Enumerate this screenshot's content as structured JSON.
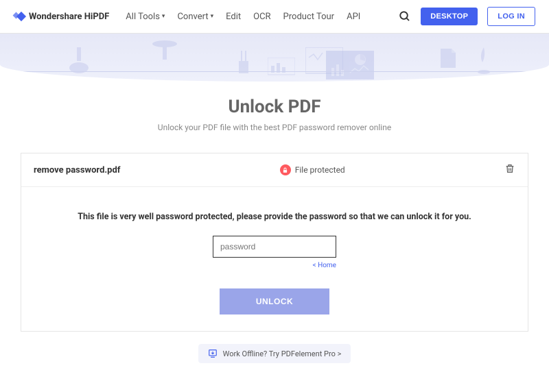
{
  "brand": "Wondershare HiPDF",
  "nav": {
    "all_tools": "All Tools",
    "convert": "Convert",
    "edit": "Edit",
    "ocr": "OCR",
    "product_tour": "Product Tour",
    "api": "API"
  },
  "buttons": {
    "desktop": "DESKTOP",
    "login": "LOG IN"
  },
  "hero": {
    "title": "Unlock PDF",
    "subtitle": "Unlock your PDF file with the best PDF password remover online"
  },
  "file": {
    "name": "remove password.pdf",
    "status": "File protected"
  },
  "content": {
    "message": "This file is very well password protected, please provide the password so that we can unlock it for you.",
    "placeholder": "password",
    "home_link": "< Home",
    "unlock": "UNLOCK"
  },
  "footer": {
    "promo": "Work Offline? Try PDFelement Pro >"
  }
}
